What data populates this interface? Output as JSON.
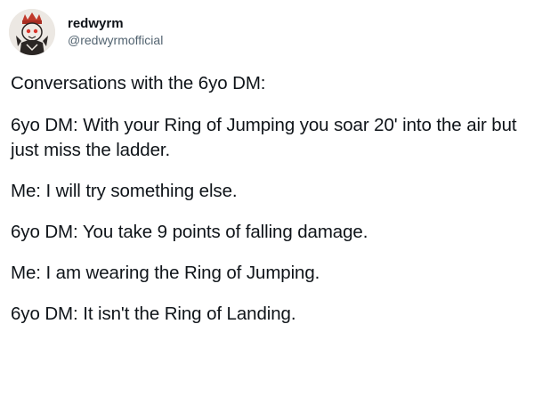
{
  "author": {
    "display_name": "redwyrm",
    "handle": "@redwyrmofficial",
    "avatar_icon": "dragon-crown-avatar",
    "avatar_colors": {
      "crown": "#c0392b",
      "skin": "#f0eae4",
      "dark": "#2b2624",
      "eye": "#d9342b"
    }
  },
  "tweet": {
    "lines": [
      "Conversations with the 6yo DM:",
      "6yo DM: With your Ring of Jumping you soar 20' into the air but just miss the ladder.",
      "Me: I will try something else.",
      "6yo DM: You take 9 points of falling damage.",
      "Me: I am wearing the Ring of Jumping.",
      "6yo DM: It isn't the Ring of Landing."
    ]
  }
}
